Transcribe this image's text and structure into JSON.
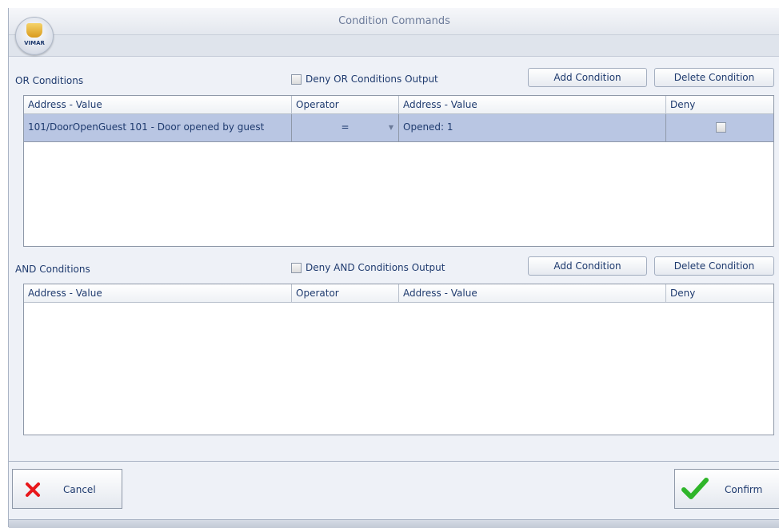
{
  "window": {
    "title": "Condition Commands",
    "logo_text": "VIMAR"
  },
  "or_section": {
    "label": "OR Conditions",
    "deny_label": "Deny OR Conditions Output",
    "add_label": "Add Condition",
    "delete_label": "Delete Condition",
    "columns": [
      "Address - Value",
      "Operator",
      "Address - Value",
      "Deny"
    ],
    "rows": [
      {
        "address": "101/DoorOpenGuest 101 - Door opened by guest",
        "operator": "=",
        "value": "Opened: 1",
        "deny": false
      }
    ]
  },
  "and_section": {
    "label": "AND Conditions",
    "deny_label": "Deny AND Conditions Output",
    "add_label": "Add Condition",
    "delete_label": "Delete Condition",
    "columns": [
      "Address - Value",
      "Operator",
      "Address - Value",
      "Deny"
    ],
    "rows": []
  },
  "footer": {
    "cancel_label": "Cancel",
    "confirm_label": "Confirm"
  },
  "colors": {
    "selected_row": "#b9c6e3",
    "cancel_icon": "#e8171b",
    "confirm_icon": "#2fb52a"
  }
}
